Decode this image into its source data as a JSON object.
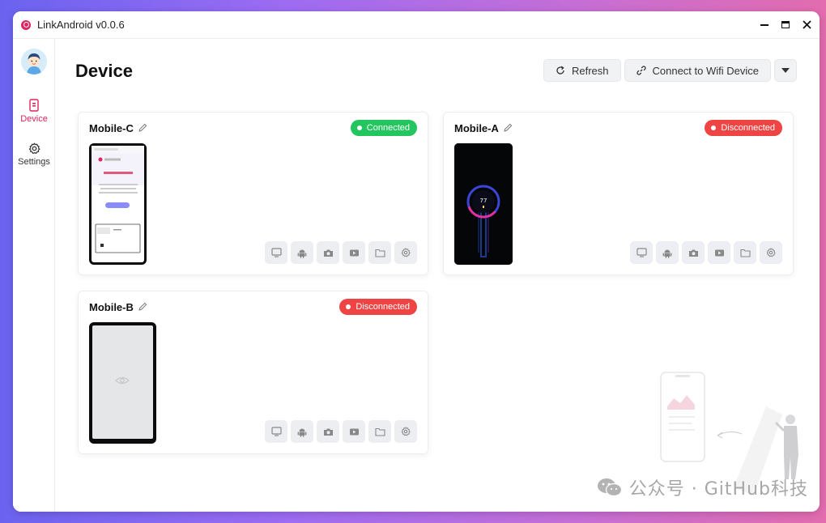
{
  "window": {
    "title": "LinkAndroid v0.0.6"
  },
  "sidebar": {
    "items": [
      {
        "label": "Device",
        "icon": "device-icon",
        "active": true
      },
      {
        "label": "Settings",
        "icon": "gear-icon",
        "active": false
      }
    ]
  },
  "main": {
    "title": "Device",
    "toolbar": {
      "refresh_label": "Refresh",
      "connect_wifi_label": "Connect to Wifi Device"
    }
  },
  "devices": [
    {
      "name": "Mobile-C",
      "status": "Connected",
      "status_color": "#22c55e"
    },
    {
      "name": "Mobile-A",
      "status": "Disconnected",
      "status_color": "#ef4444"
    },
    {
      "name": "Mobile-B",
      "status": "Disconnected",
      "status_color": "#ef4444"
    }
  ],
  "mobile_a_screen": {
    "battery": "77"
  },
  "card_actions": [
    "screen-mirror-icon",
    "android-icon",
    "camera-icon",
    "record-video-icon",
    "folder-icon",
    "settings-icon"
  ],
  "watermark": {
    "text": "公众号 · GitHub科技"
  },
  "colors": {
    "accent": "#e0245e",
    "connected": "#22c55e",
    "disconnected": "#ef4444"
  }
}
